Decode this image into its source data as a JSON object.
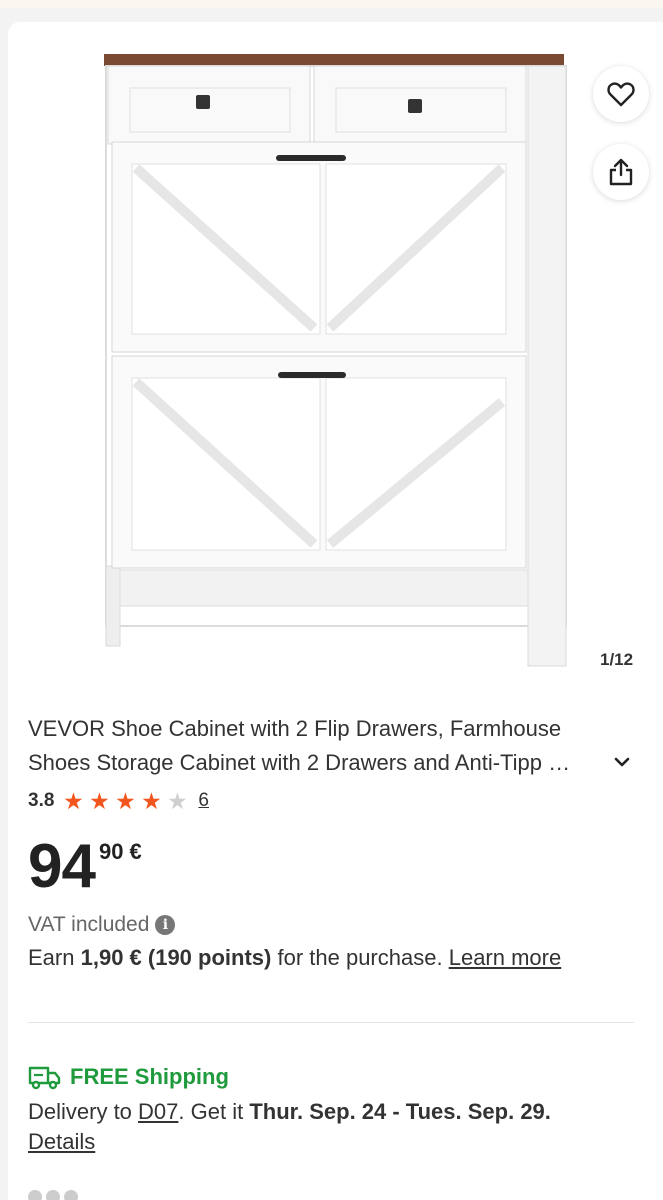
{
  "gallery": {
    "counter": "1/12",
    "favorite_icon": "heart-outline-icon",
    "share_icon": "share-icon"
  },
  "product": {
    "title_line1": "VEVOR Shoe Cabinet with 2 Flip Drawers, Farmhouse",
    "title_line2": "Shoes Storage Cabinet with 2 Drawers and Anti-Tipp …",
    "expand_icon": "chevron-down-icon",
    "rating": {
      "value": "3.8",
      "stars": 3.8,
      "max": 5,
      "count": "6",
      "color": "#f3551f"
    },
    "price": {
      "integer": "94",
      "decimal": "90 €"
    },
    "vat": "VAT included",
    "earn": {
      "prefix": "Earn",
      "amount": "1,90 € (190 points)",
      "suffix": "for the purchase.",
      "link": "Learn more"
    }
  },
  "shipping": {
    "icon": "truck-icon",
    "label": "FREE Shipping",
    "color": "#1f9a3c",
    "delivery_prefix": "Delivery to",
    "location": "D07",
    "get_it": ". Get it",
    "dates": "Thur. Sep. 24 - Tues. Sep. 29.",
    "details": "Details"
  }
}
